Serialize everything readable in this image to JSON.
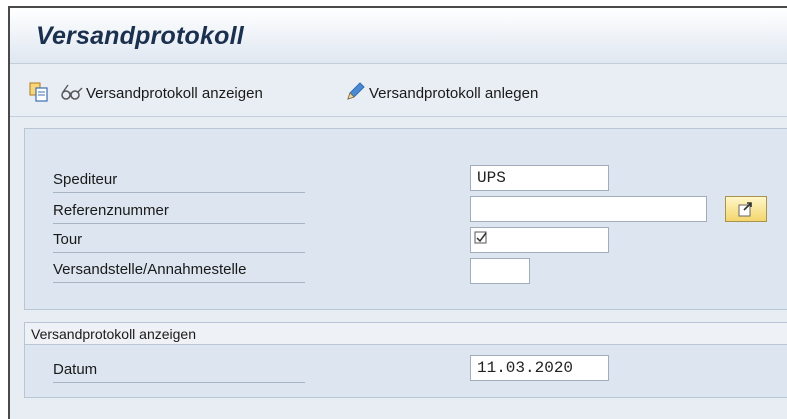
{
  "window": {
    "title": "Versandprotokoll"
  },
  "toolbar": {
    "show_label": "Versandprotokoll anzeigen",
    "create_label": "Versandprotokoll anlegen"
  },
  "selection": {
    "fields": [
      {
        "label": "Spediteur",
        "value": "UPS"
      },
      {
        "label": "Referenznummer",
        "value": ""
      },
      {
        "label": "Tour",
        "value": ""
      },
      {
        "label": "Versandstelle/Annahmestelle",
        "value": ""
      }
    ]
  },
  "display_frame": {
    "title": "Versandprotokoll anzeigen",
    "date_label": "Datum",
    "date_value": "11.03.2020"
  },
  "colors": {
    "accent_yellow": "#f3d66d",
    "title_text": "#1b2f4e",
    "pencil_blue": "#2f6fb5"
  }
}
